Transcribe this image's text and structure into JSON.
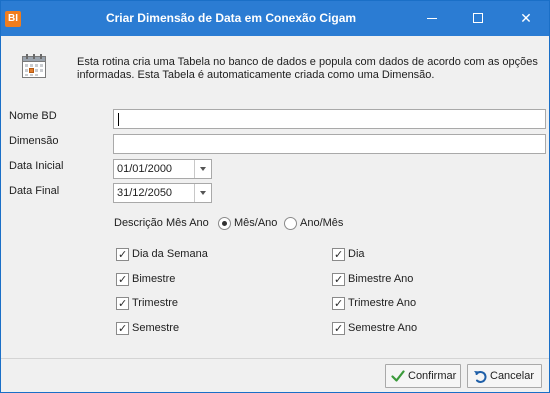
{
  "window": {
    "app_icon_text": "BI",
    "title": "Criar Dimensão de Data em Conexão Cigam",
    "minimize_glyph": "minimize-icon",
    "maximize_glyph": "maximize-icon",
    "close_glyph": "✕"
  },
  "header": {
    "icon": "calendar-icon",
    "description": "Esta rotina cria uma Tabela no banco de dados e popula com dados de acordo com as opções informadas. Esta Tabela é automaticamente criada como uma Dimensão."
  },
  "form": {
    "nome_bd": {
      "label": "Nome BD",
      "value": ""
    },
    "dimensao": {
      "label": "Dimensão",
      "value": ""
    },
    "data_inicial": {
      "label": "Data Inicial",
      "value": "01/01/2000"
    },
    "data_final": {
      "label": "Data Final",
      "value": "31/12/2050"
    },
    "descricao_mes_ano": {
      "label": "Descrição Mês Ano",
      "options": [
        {
          "label": "Mês/Ano",
          "selected": true
        },
        {
          "label": "Ano/Mês",
          "selected": false
        }
      ]
    },
    "checkboxes": [
      {
        "label": "Dia da Semana",
        "checked": true
      },
      {
        "label": "Dia",
        "checked": true
      },
      {
        "label": "Bimestre",
        "checked": true
      },
      {
        "label": "Bimestre Ano",
        "checked": true
      },
      {
        "label": "Trimestre",
        "checked": true
      },
      {
        "label": "Trimestre Ano",
        "checked": true
      },
      {
        "label": "Semestre",
        "checked": true
      },
      {
        "label": "Semestre Ano",
        "checked": true
      }
    ]
  },
  "footer": {
    "confirm_label": "Confirmar",
    "cancel_label": "Cancelar"
  },
  "colors": {
    "titlebar": "#2b7cd3",
    "app_icon": "#f07d1e",
    "confirm_icon": "#3a9a3a",
    "cancel_icon": "#1f5fa8"
  }
}
